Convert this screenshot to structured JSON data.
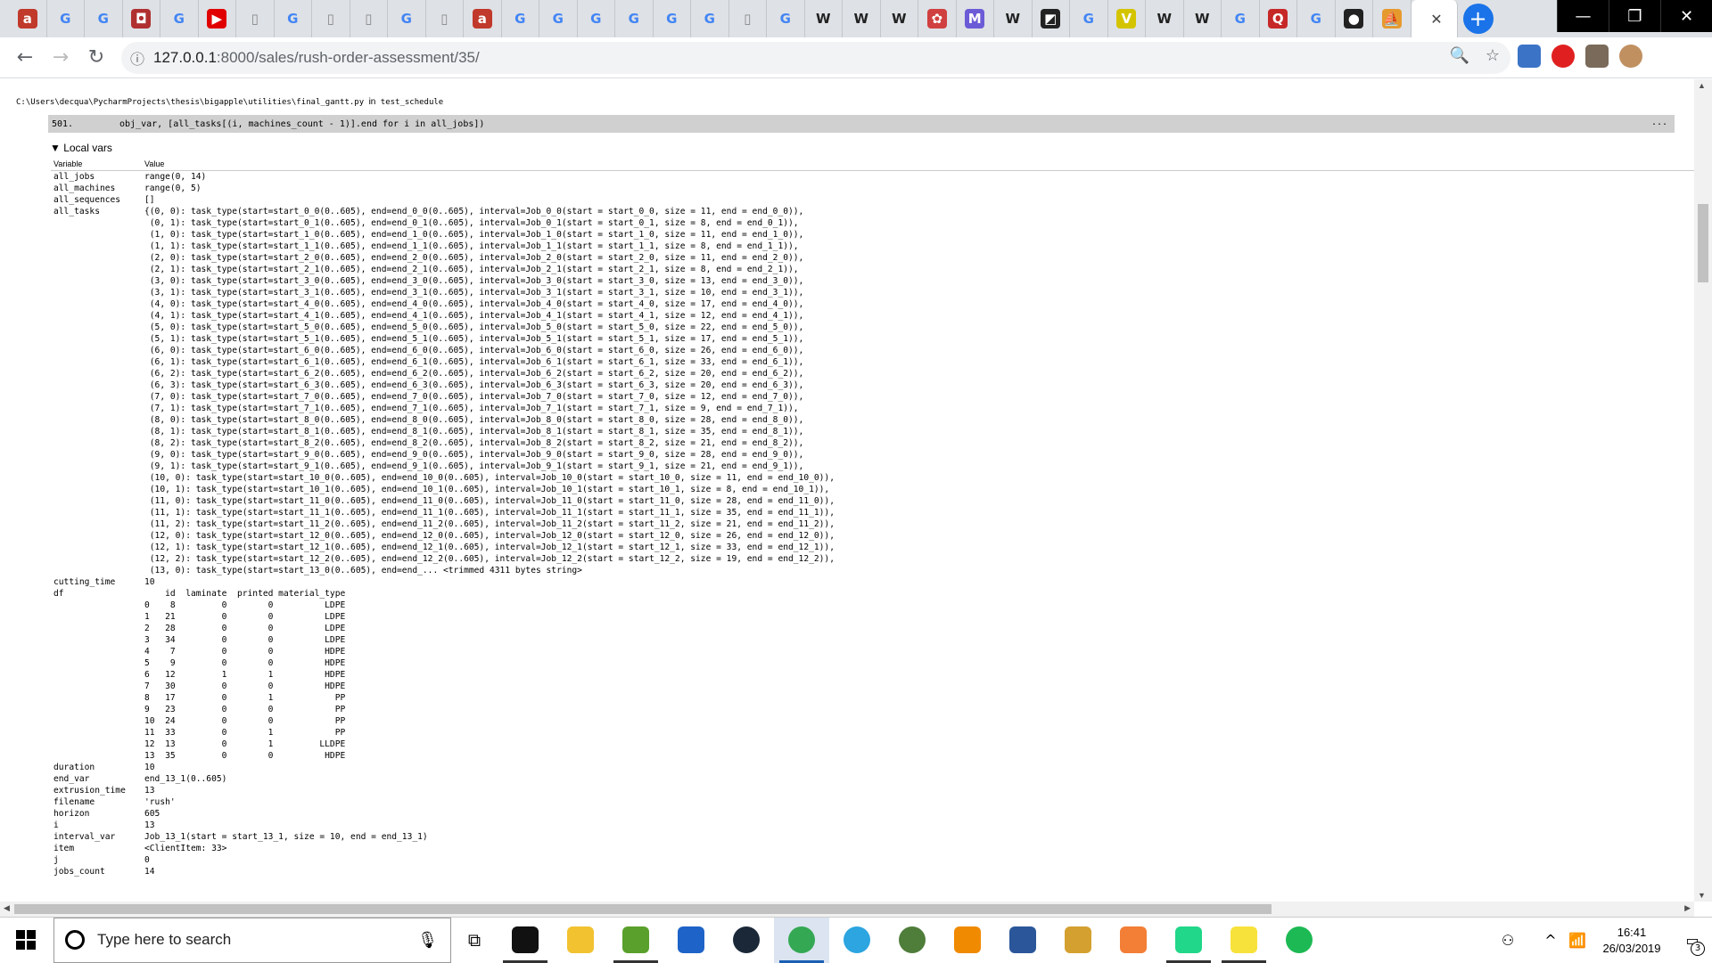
{
  "browser": {
    "tabs": [
      {
        "icon": "amazon-icon",
        "glyph": "a",
        "color": "#c0392b"
      },
      {
        "icon": "google-icon",
        "glyph": "G",
        "color": "#4285f4"
      },
      {
        "icon": "google-icon",
        "glyph": "G",
        "color": "#4285f4"
      },
      {
        "icon": "bookmark-icon",
        "glyph": "◘",
        "color": "#b03030"
      },
      {
        "icon": "google-icon",
        "glyph": "G",
        "color": "#4285f4"
      },
      {
        "icon": "youtube-icon",
        "glyph": "▶",
        "color": "#e00000"
      },
      {
        "icon": "document-icon",
        "glyph": "▯",
        "color": "#888888"
      },
      {
        "icon": "google-icon",
        "glyph": "G",
        "color": "#4285f4"
      },
      {
        "icon": "document-icon",
        "glyph": "▯",
        "color": "#888888"
      },
      {
        "icon": "document-icon",
        "glyph": "▯",
        "color": "#888888"
      },
      {
        "icon": "google-icon",
        "glyph": "G",
        "color": "#4285f4"
      },
      {
        "icon": "document-icon",
        "glyph": "▯",
        "color": "#888888"
      },
      {
        "icon": "amazon-icon",
        "glyph": "a",
        "color": "#c0392b"
      },
      {
        "icon": "google-icon",
        "glyph": "G",
        "color": "#4285f4"
      },
      {
        "icon": "google-icon",
        "glyph": "G",
        "color": "#4285f4"
      },
      {
        "icon": "google-icon",
        "glyph": "G",
        "color": "#4285f4"
      },
      {
        "icon": "google-icon",
        "glyph": "G",
        "color": "#4285f4"
      },
      {
        "icon": "google-icon",
        "glyph": "G",
        "color": "#4285f4"
      },
      {
        "icon": "google-icon",
        "glyph": "G",
        "color": "#4285f4"
      },
      {
        "icon": "document-icon",
        "glyph": "▯",
        "color": "#888888"
      },
      {
        "icon": "google-icon",
        "glyph": "G",
        "color": "#4285f4"
      },
      {
        "icon": "wikipedia-icon",
        "glyph": "W",
        "color": "#222222"
      },
      {
        "icon": "wikipedia-icon",
        "glyph": "W",
        "color": "#222222"
      },
      {
        "icon": "wikipedia-icon",
        "glyph": "W",
        "color": "#222222"
      },
      {
        "icon": "app-icon",
        "glyph": "✿",
        "color": "#d04040"
      },
      {
        "icon": "m-icon",
        "glyph": "M",
        "color": "#6b5bd6"
      },
      {
        "icon": "wikipedia-icon",
        "glyph": "W",
        "color": "#222222"
      },
      {
        "icon": "dark-icon",
        "glyph": "◩",
        "color": "#222222"
      },
      {
        "icon": "google-icon",
        "glyph": "G",
        "color": "#4285f4"
      },
      {
        "icon": "v-icon",
        "glyph": "V",
        "color": "#d4c400"
      },
      {
        "icon": "wikipedia-icon",
        "glyph": "W",
        "color": "#222222"
      },
      {
        "icon": "wikipedia-icon",
        "glyph": "W",
        "color": "#222222"
      },
      {
        "icon": "google-icon",
        "glyph": "G",
        "color": "#4285f4"
      },
      {
        "icon": "q-icon",
        "glyph": "Q",
        "color": "#c62828"
      },
      {
        "icon": "google-icon",
        "glyph": "G",
        "color": "#4285f4"
      },
      {
        "icon": "github-icon",
        "glyph": "●",
        "color": "#222222"
      },
      {
        "icon": "pma-icon",
        "glyph": "⛵",
        "color": "#e69a2e"
      }
    ],
    "active_tab_close": "✕",
    "new_tab": "+",
    "window": {
      "minimize": "—",
      "maximize": "❐",
      "close": "✕"
    },
    "nav": {
      "back": "←",
      "forward": "→",
      "reload": "↻"
    },
    "url_host": "127.0.0.1",
    "url_path": ":8000/sales/rush-order-assessment/35/",
    "omni_info": "ⓘ",
    "zoom_icon": "🔍",
    "star_icon": "☆"
  },
  "page": {
    "frame_file_path": "C:\\Users\\decqua\\PycharmProjects\\thesis\\bigapple\\utilities\\final_gantt.py",
    "frame_in": "in",
    "frame_function": "test_schedule",
    "code_line_number": "501.",
    "code_line": "obj_var, [all_tasks[(i, machines_count - 1)].end for i in all_jobs])",
    "code_ellipsis": "...",
    "local_vars_toggle": "▼ Local vars",
    "table_headers": {
      "variable": "Variable",
      "value": "Value"
    },
    "variables": [
      {
        "name": "all_jobs",
        "value": "range(0, 14)"
      },
      {
        "name": "all_machines",
        "value": "range(0, 5)"
      },
      {
        "name": "all_sequences",
        "value": "[]"
      },
      {
        "name": "all_tasks",
        "value": "{(0, 0): task_type(start=start_0_0(0..605), end=end_0_0(0..605), interval=Job_0_0(start = start_0_0, size = 11, end = end_0_0)),\n (0, 1): task_type(start=start_0_1(0..605), end=end_0_1(0..605), interval=Job_0_1(start = start_0_1, size = 8, end = end_0_1)),\n (1, 0): task_type(start=start_1_0(0..605), end=end_1_0(0..605), interval=Job_1_0(start = start_1_0, size = 11, end = end_1_0)),\n (1, 1): task_type(start=start_1_1(0..605), end=end_1_1(0..605), interval=Job_1_1(start = start_1_1, size = 8, end = end_1_1)),\n (2, 0): task_type(start=start_2_0(0..605), end=end_2_0(0..605), interval=Job_2_0(start = start_2_0, size = 11, end = end_2_0)),\n (2, 1): task_type(start=start_2_1(0..605), end=end_2_1(0..605), interval=Job_2_1(start = start_2_1, size = 8, end = end_2_1)),\n (3, 0): task_type(start=start_3_0(0..605), end=end_3_0(0..605), interval=Job_3_0(start = start_3_0, size = 13, end = end_3_0)),\n (3, 1): task_type(start=start_3_1(0..605), end=end_3_1(0..605), interval=Job_3_1(start = start_3_1, size = 10, end = end_3_1)),\n (4, 0): task_type(start=start_4_0(0..605), end=end_4_0(0..605), interval=Job_4_0(start = start_4_0, size = 17, end = end_4_0)),\n (4, 1): task_type(start=start_4_1(0..605), end=end_4_1(0..605), interval=Job_4_1(start = start_4_1, size = 12, end = end_4_1)),\n (5, 0): task_type(start=start_5_0(0..605), end=end_5_0(0..605), interval=Job_5_0(start = start_5_0, size = 22, end = end_5_0)),\n (5, 1): task_type(start=start_5_1(0..605), end=end_5_1(0..605), interval=Job_5_1(start = start_5_1, size = 17, end = end_5_1)),\n (6, 0): task_type(start=start_6_0(0..605), end=end_6_0(0..605), interval=Job_6_0(start = start_6_0, size = 26, end = end_6_0)),\n (6, 1): task_type(start=start_6_1(0..605), end=end_6_1(0..605), interval=Job_6_1(start = start_6_1, size = 33, end = end_6_1)),\n (6, 2): task_type(start=start_6_2(0..605), end=end_6_2(0..605), interval=Job_6_2(start = start_6_2, size = 20, end = end_6_2)),\n (6, 3): task_type(start=start_6_3(0..605), end=end_6_3(0..605), interval=Job_6_3(start = start_6_3, size = 20, end = end_6_3)),\n (7, 0): task_type(start=start_7_0(0..605), end=end_7_0(0..605), interval=Job_7_0(start = start_7_0, size = 12, end = end_7_0)),\n (7, 1): task_type(start=start_7_1(0..605), end=end_7_1(0..605), interval=Job_7_1(start = start_7_1, size = 9, end = end_7_1)),\n (8, 0): task_type(start=start_8_0(0..605), end=end_8_0(0..605), interval=Job_8_0(start = start_8_0, size = 28, end = end_8_0)),\n (8, 1): task_type(start=start_8_1(0..605), end=end_8_1(0..605), interval=Job_8_1(start = start_8_1, size = 35, end = end_8_1)),\n (8, 2): task_type(start=start_8_2(0..605), end=end_8_2(0..605), interval=Job_8_2(start = start_8_2, size = 21, end = end_8_2)),\n (9, 0): task_type(start=start_9_0(0..605), end=end_9_0(0..605), interval=Job_9_0(start = start_9_0, size = 28, end = end_9_0)),\n (9, 1): task_type(start=start_9_1(0..605), end=end_9_1(0..605), interval=Job_9_1(start = start_9_1, size = 21, end = end_9_1)),\n (10, 0): task_type(start=start_10_0(0..605), end=end_10_0(0..605), interval=Job_10_0(start = start_10_0, size = 11, end = end_10_0)),\n (10, 1): task_type(start=start_10_1(0..605), end=end_10_1(0..605), interval=Job_10_1(start = start_10_1, size = 8, end = end_10_1)),\n (11, 0): task_type(start=start_11_0(0..605), end=end_11_0(0..605), interval=Job_11_0(start = start_11_0, size = 28, end = end_11_0)),\n (11, 1): task_type(start=start_11_1(0..605), end=end_11_1(0..605), interval=Job_11_1(start = start_11_1, size = 35, end = end_11_1)),\n (11, 2): task_type(start=start_11_2(0..605), end=end_11_2(0..605), interval=Job_11_2(start = start_11_2, size = 21, end = end_11_2)),\n (12, 0): task_type(start=start_12_0(0..605), end=end_12_0(0..605), interval=Job_12_0(start = start_12_0, size = 26, end = end_12_0)),\n (12, 1): task_type(start=start_12_1(0..605), end=end_12_1(0..605), interval=Job_12_1(start = start_12_1, size = 33, end = end_12_1)),\n (12, 2): task_type(start=start_12_2(0..605), end=end_12_2(0..605), interval=Job_12_2(start = start_12_2, size = 19, end = end_12_2)),\n (13, 0): task_type(start=start_13_0(0..605), end=end_... <trimmed 4311 bytes string>"
      },
      {
        "name": "cutting_time",
        "value": "10"
      },
      {
        "name": "df",
        "value": "    id  laminate  printed material_type\n0    8         0        0          LDPE\n1   21         0        0          LDPE\n2   28         0        0          LDPE\n3   34         0        0          LDPE\n4    7         0        0          HDPE\n5    9         0        0          HDPE\n6   12         1        1          HDPE\n7   30         0        0          HDPE\n8   17         0        1            PP\n9   23         0        0            PP\n10  24         0        0            PP\n11  33         0        1            PP\n12  13         0        1         LLDPE\n13  35         0        0          HDPE"
      },
      {
        "name": "duration",
        "value": "10"
      },
      {
        "name": "end_var",
        "value": "end_13_1(0..605)"
      },
      {
        "name": "extrusion_time",
        "value": "13"
      },
      {
        "name": "filename",
        "value": "'rush'"
      },
      {
        "name": "horizon",
        "value": "605"
      },
      {
        "name": "i",
        "value": "13"
      },
      {
        "name": "interval_var",
        "value": "Job_13_1(start = start_13_1, size = 10, end = end_13_1)"
      },
      {
        "name": "item",
        "value": "<ClientItem: 33>"
      },
      {
        "name": "j",
        "value": "0"
      },
      {
        "name": "jobs_count",
        "value": "14"
      }
    ]
  },
  "taskbar": {
    "search_placeholder": "Type here to search",
    "mic_icon": "🎙",
    "taskview_icon": "⧉",
    "apps": [
      {
        "name": "terminal",
        "color": "#111111",
        "open": true
      },
      {
        "name": "file-explorer",
        "color": "#f2c230",
        "open": false
      },
      {
        "name": "image-editor",
        "color": "#5aa02c",
        "open": true
      },
      {
        "name": "app-blue",
        "color": "#1e63c8",
        "open": false
      },
      {
        "name": "steam",
        "color": "#1b2838",
        "open": false
      },
      {
        "name": "chrome",
        "color": "#34a853",
        "open": true,
        "active": true
      },
      {
        "name": "telegram",
        "color": "#2ca5e0",
        "open": false
      },
      {
        "name": "globe",
        "color": "#4f7d3a",
        "open": false
      },
      {
        "name": "vlc",
        "color": "#f08a00",
        "open": false
      },
      {
        "name": "word",
        "color": "#2b579a",
        "open": false
      },
      {
        "name": "paint",
        "color": "#d4a030",
        "open": false
      },
      {
        "name": "xampp",
        "color": "#f37e35",
        "open": false
      },
      {
        "name": "pycharm",
        "color": "#21d789",
        "open": true
      },
      {
        "name": "sticky-notes",
        "color": "#f7e23b",
        "open": true
      },
      {
        "name": "spotify",
        "color": "#1db954",
        "open": false
      }
    ],
    "tray": {
      "people": "⚇",
      "chevron": "^",
      "wifi": "📶"
    },
    "time": "16:41",
    "date": "26/03/2019",
    "notifications_icon": "▭",
    "notification_count": "3"
  }
}
